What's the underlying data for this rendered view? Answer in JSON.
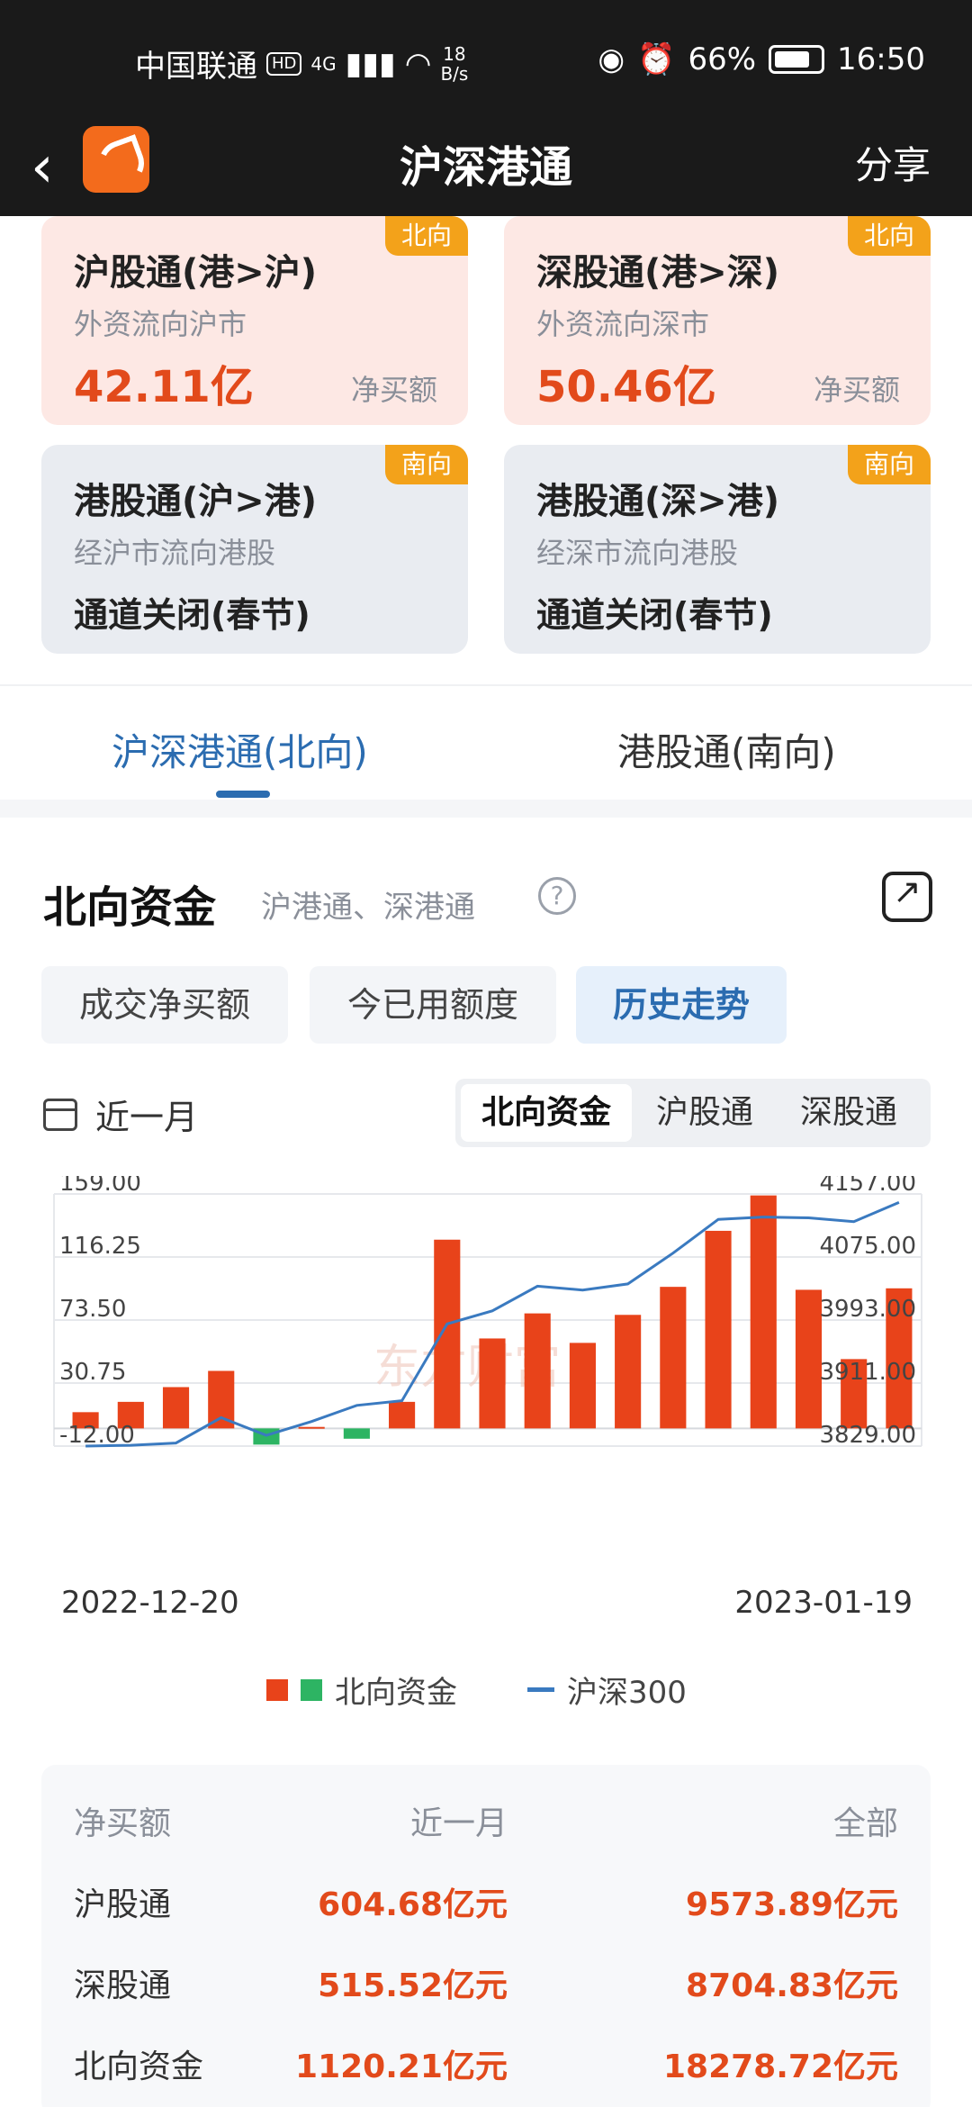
{
  "status_bar": {
    "carrier": "中国联通",
    "hd": "HD",
    "network": "4G",
    "speed_top": "18",
    "speed_bottom": "B/s",
    "battery": "66%",
    "time": "16:50"
  },
  "header": {
    "title": "沪深港通",
    "share": "分享"
  },
  "cards": [
    {
      "name": "沪股通(港>沪)",
      "desc": "外资流向沪市",
      "value": "42.11亿",
      "unit": "净买额",
      "tag": "北向"
    },
    {
      "name": "深股通(港>深)",
      "desc": "外资流向深市",
      "value": "50.46亿",
      "unit": "净买额",
      "tag": "北向"
    },
    {
      "name": "港股通(沪>港)",
      "desc": "经沪市流向港股",
      "status": "通道关闭(春节)",
      "tag": "南向"
    },
    {
      "name": "港股通(深>港)",
      "desc": "经深市流向港股",
      "status": "通道关闭(春节)",
      "tag": "南向"
    }
  ],
  "tabs": [
    "沪深港通(北向)",
    "港股通(南向)"
  ],
  "section": {
    "title": "北向资金",
    "subtitle": "沪港通、深港通",
    "help": "?",
    "segments": [
      "成交净买额",
      "今已用额度",
      "历史走势"
    ],
    "period": "近一月",
    "switch": [
      "北向资金",
      "沪股通",
      "深股通"
    ],
    "date_start": "2022-12-20",
    "date_end": "2023-01-19",
    "legend_bar": "北向资金",
    "legend_line": "沪深300"
  },
  "chart_data": {
    "type": "bar",
    "left_axis_ticks": [
      "159.00",
      "116.25",
      "73.50",
      "30.75",
      "-12.00"
    ],
    "right_axis_ticks": [
      "4157.00",
      "4075.00",
      "3993.00",
      "3911.00",
      "3829.00"
    ],
    "ylim_left": [
      -12,
      159
    ],
    "ylim_right": [
      3829,
      4157
    ],
    "series": [
      {
        "name": "北向资金",
        "type": "bar",
        "values": [
          11,
          18,
          28,
          39,
          -11,
          1,
          -7,
          18,
          128,
          61,
          78,
          58,
          77,
          96,
          134,
          158,
          94,
          47,
          95
        ]
      },
      {
        "name": "沪深300",
        "type": "line",
        "values": [
          3829,
          3830,
          3833,
          3866,
          3843,
          3861,
          3882,
          3888,
          3988,
          4005,
          4037,
          4032,
          4040,
          4080,
          4124,
          4127,
          4126,
          4121,
          4146
        ]
      }
    ],
    "colors": {
      "positive": "#e8431a",
      "negative": "#2db463",
      "line": "#3a7ac0"
    },
    "watermark": "东方财富"
  },
  "table": {
    "header": [
      "净买额",
      "近一月",
      "全部"
    ],
    "rows": [
      [
        "沪股通",
        "604.68亿元",
        "9573.89亿元"
      ],
      [
        "深股通",
        "515.52亿元",
        "8704.83亿元"
      ],
      [
        "北向资金",
        "1120.21亿元",
        "18278.72亿元"
      ]
    ]
  }
}
